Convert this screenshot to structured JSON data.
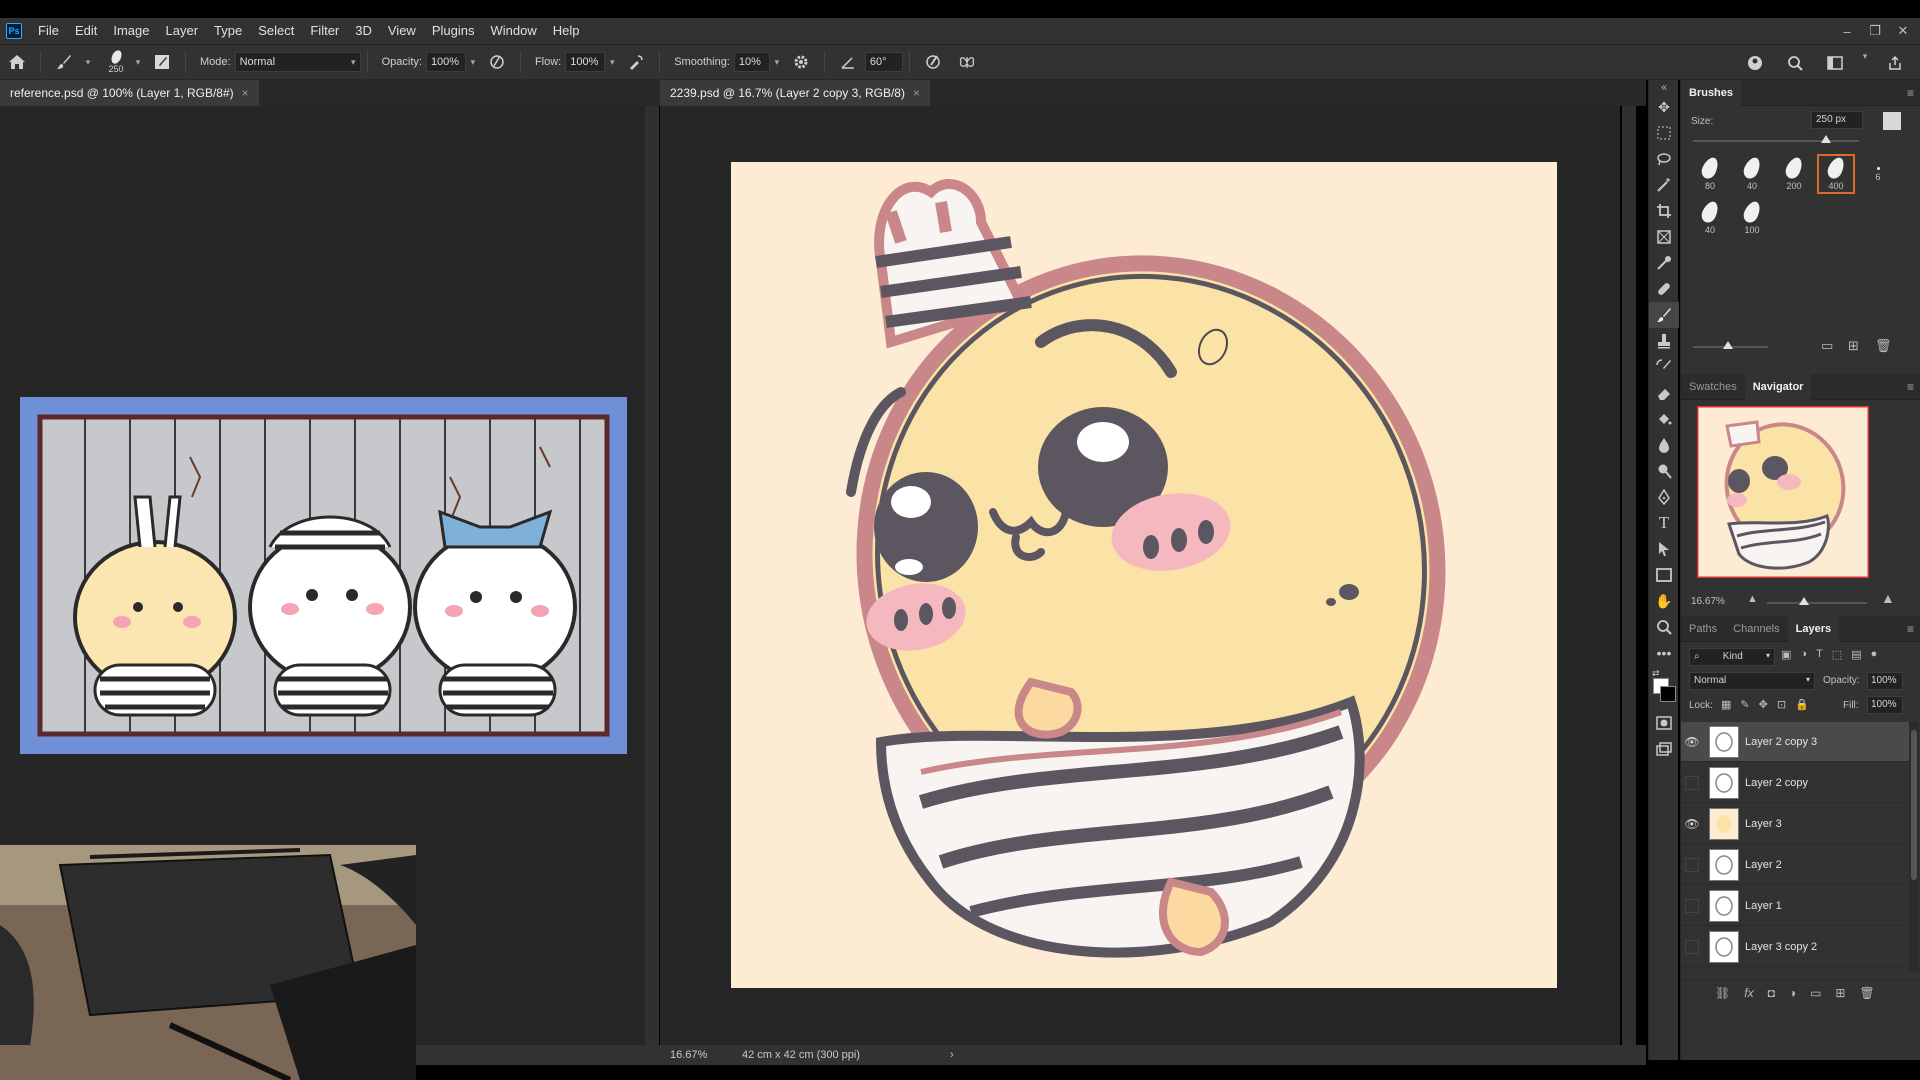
{
  "app": {
    "logo": "Ps"
  },
  "menu": [
    "File",
    "Edit",
    "Image",
    "Layer",
    "Type",
    "Select",
    "Filter",
    "3D",
    "View",
    "Plugins",
    "Window",
    "Help"
  ],
  "window_controls": {
    "minimize": "–",
    "restore": "❐",
    "close": "✕"
  },
  "options": {
    "brush_size": "250",
    "mode_label": "Mode:",
    "mode_value": "Normal",
    "opacity_label": "Opacity:",
    "opacity_value": "100%",
    "flow_label": "Flow:",
    "flow_value": "100%",
    "smoothing_label": "Smoothing:",
    "smoothing_value": "10%",
    "angle_value": "60°"
  },
  "tabs": {
    "left": "reference.psd @ 100% (Layer 1, RGB/8#)",
    "right": "2239.psd @ 16.7% (Layer 2 copy 3, RGB/8)",
    "close": "×"
  },
  "status": {
    "zoom": "16.67%",
    "doc_size": "42 cm x 42 cm (300 ppi)",
    "arrow": "›"
  },
  "brushes": {
    "title": "Brushes",
    "size_label": "Size:",
    "size_value": "250 px",
    "tips": [
      "80",
      "40",
      "200",
      "400",
      "6",
      "40",
      "100"
    ],
    "selected_tip_index": 3
  },
  "navigator": {
    "tabs": [
      "Swatches",
      "Navigator"
    ],
    "active_tab": "Navigator",
    "zoom": "16.67%"
  },
  "layers_panel": {
    "tabs": [
      "Paths",
      "Channels",
      "Layers"
    ],
    "active_tab": "Layers",
    "filter_kind": "Kind",
    "blend_mode": "Normal",
    "opacity_label": "Opacity:",
    "opacity_value": "100%",
    "lock_label": "Lock:",
    "fill_label": "Fill:",
    "fill_value": "100%",
    "layers": [
      {
        "name": "Layer 2 copy 3",
        "visible": true,
        "selected": true
      },
      {
        "name": "Layer 2 copy",
        "visible": false,
        "selected": false
      },
      {
        "name": "Layer 3",
        "visible": true,
        "selected": false
      },
      {
        "name": "Layer 2",
        "visible": false,
        "selected": false
      },
      {
        "name": "Layer 1",
        "visible": false,
        "selected": false
      },
      {
        "name": "Layer 3 copy 2",
        "visible": false,
        "selected": false
      }
    ]
  },
  "colors": {
    "canvas_bg": "#fdebd3",
    "character_fill": "#fbe3a8",
    "outline": "#5b5660",
    "blush": "#f5b8bf",
    "accent_selection": "#e06a2a"
  }
}
